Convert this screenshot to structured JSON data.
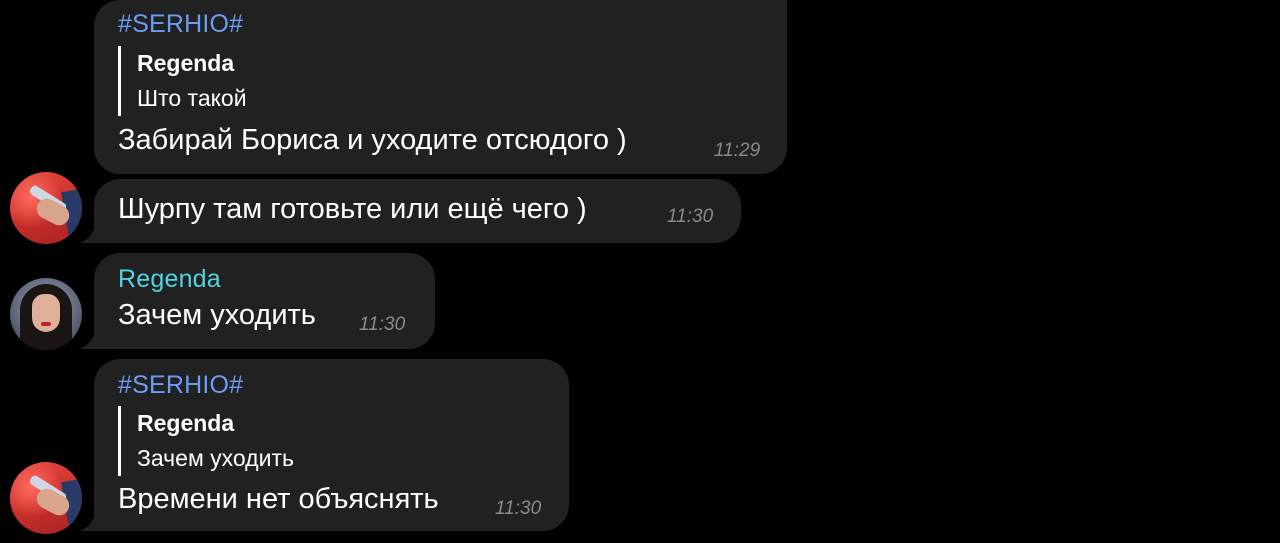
{
  "messages": [
    {
      "sender": "#SERHIO#",
      "reply": {
        "author": "Regenda",
        "text": "Што такой"
      },
      "text": "Забирай Бориса и уходите отсюдого )",
      "time": "11:29"
    },
    {
      "text": "Шурпу там готовьте или ещё чего )",
      "time": "11:30"
    },
    {
      "sender": "Regenda",
      "text": "Зачем уходить",
      "time": "11:30"
    },
    {
      "sender": "#SERHIO#",
      "reply": {
        "author": "Regenda",
        "text": "Зачем уходить"
      },
      "text": "Времени нет объяснять",
      "time": "11:30"
    }
  ],
  "colors": {
    "background": "#000000",
    "bubble": "#212121",
    "serhio_name": "#6c9df5",
    "regenda_name": "#4fd6e2",
    "timestamp": "#8a8a8e"
  }
}
